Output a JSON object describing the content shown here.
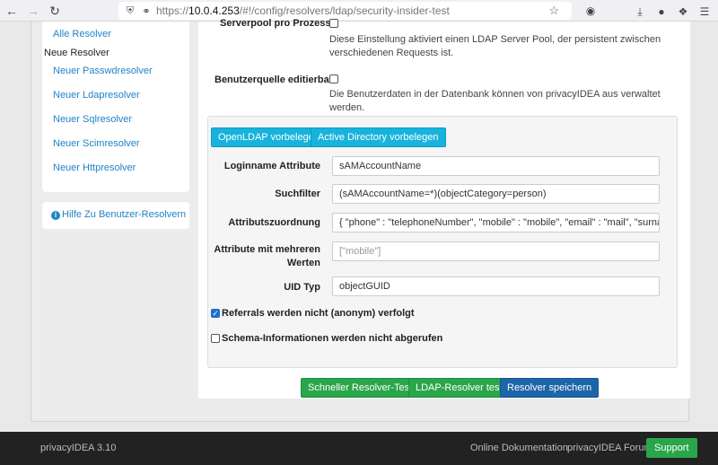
{
  "browser": {
    "url_scheme": "https://",
    "url_host": "10.0.4.253",
    "url_path": "/#!/config/resolvers/ldap/security-insider-test"
  },
  "sidebar": {
    "all_resolvers": "Alle Resolver",
    "new_resolver_heading": "Neue Resolver",
    "items": [
      "Neuer Passwdresolver",
      "Neuer Ldapresolver",
      "Neuer Sqlresolver",
      "Neuer Scimresolver",
      "Neuer Httpresolver"
    ],
    "help_link": "Hilfe Zu Benutzer-Resolvern"
  },
  "main": {
    "serverpool_label": "Serverpool pro Prozess",
    "serverpool_desc": "Diese Einstellung aktiviert einen LDAP Server Pool, der persistent zwischen verschiedenen Requests ist.",
    "editable_label": "Benutzerquelle editierbar",
    "editable_desc": "Die Benutzerdaten in der Datenbank können von privacyIDEA aus verwaltet werden.",
    "preset_openldap": "OpenLDAP vorbelegen",
    "preset_ad": "Active Directory vorbelegen",
    "fields": {
      "login_label": "Loginname Attribute",
      "login_value": "sAMAccountName",
      "search_label": "Suchfilter",
      "search_value": "(sAMAccountName=*)(objectCategory=person)",
      "mapping_label": "Attributszuordnung",
      "mapping_value": "{ \"phone\" : \"telephoneNumber\", \"mobile\" : \"mobile\", \"email\" : \"mail\", \"surname\" : \"sn\", \"givenname\" : \"givenName\" }",
      "multi_label_1": "Attribute mit mehreren",
      "multi_label_2": "Werten",
      "multi_placeholder": "[\"mobile\"]",
      "uid_label": "UID Typ",
      "uid_value": "objectGUID"
    },
    "referrals_label": "Referrals werden nicht (anonym) verfolgt",
    "referrals_checked": true,
    "schema_label": "Schema-Informationen werden nicht abgerufen",
    "schema_checked": false,
    "btn_quick_test": "Schneller Resolver-Test",
    "btn_ldap_test": "LDAP-Resolver testen",
    "btn_save": "Resolver speichern"
  },
  "footer": {
    "brand": "privacyIDEA 3.10",
    "docs": "Online Dokumentation",
    "forum": "privacyIDEA Forum",
    "support": "Support"
  }
}
